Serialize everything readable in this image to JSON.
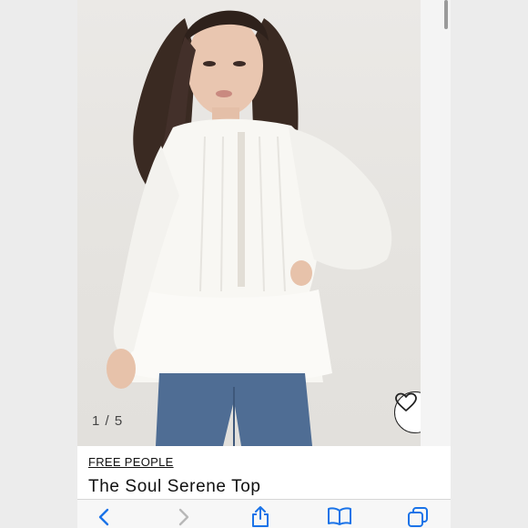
{
  "gallery": {
    "counter": "1 / 5",
    "current": 1,
    "total": 5
  },
  "product": {
    "brand": "FREE PEOPLE",
    "title": "The Soul Serene Top"
  },
  "icons": {
    "favorite": "heart-icon",
    "back": "chevron-left-icon",
    "forward": "chevron-right-icon",
    "share": "share-icon",
    "bookmarks": "book-icon",
    "tabs": "tabs-icon"
  },
  "colors": {
    "accent": "#1a73e8",
    "disabled": "#b8b8b8",
    "text": "#111111"
  }
}
